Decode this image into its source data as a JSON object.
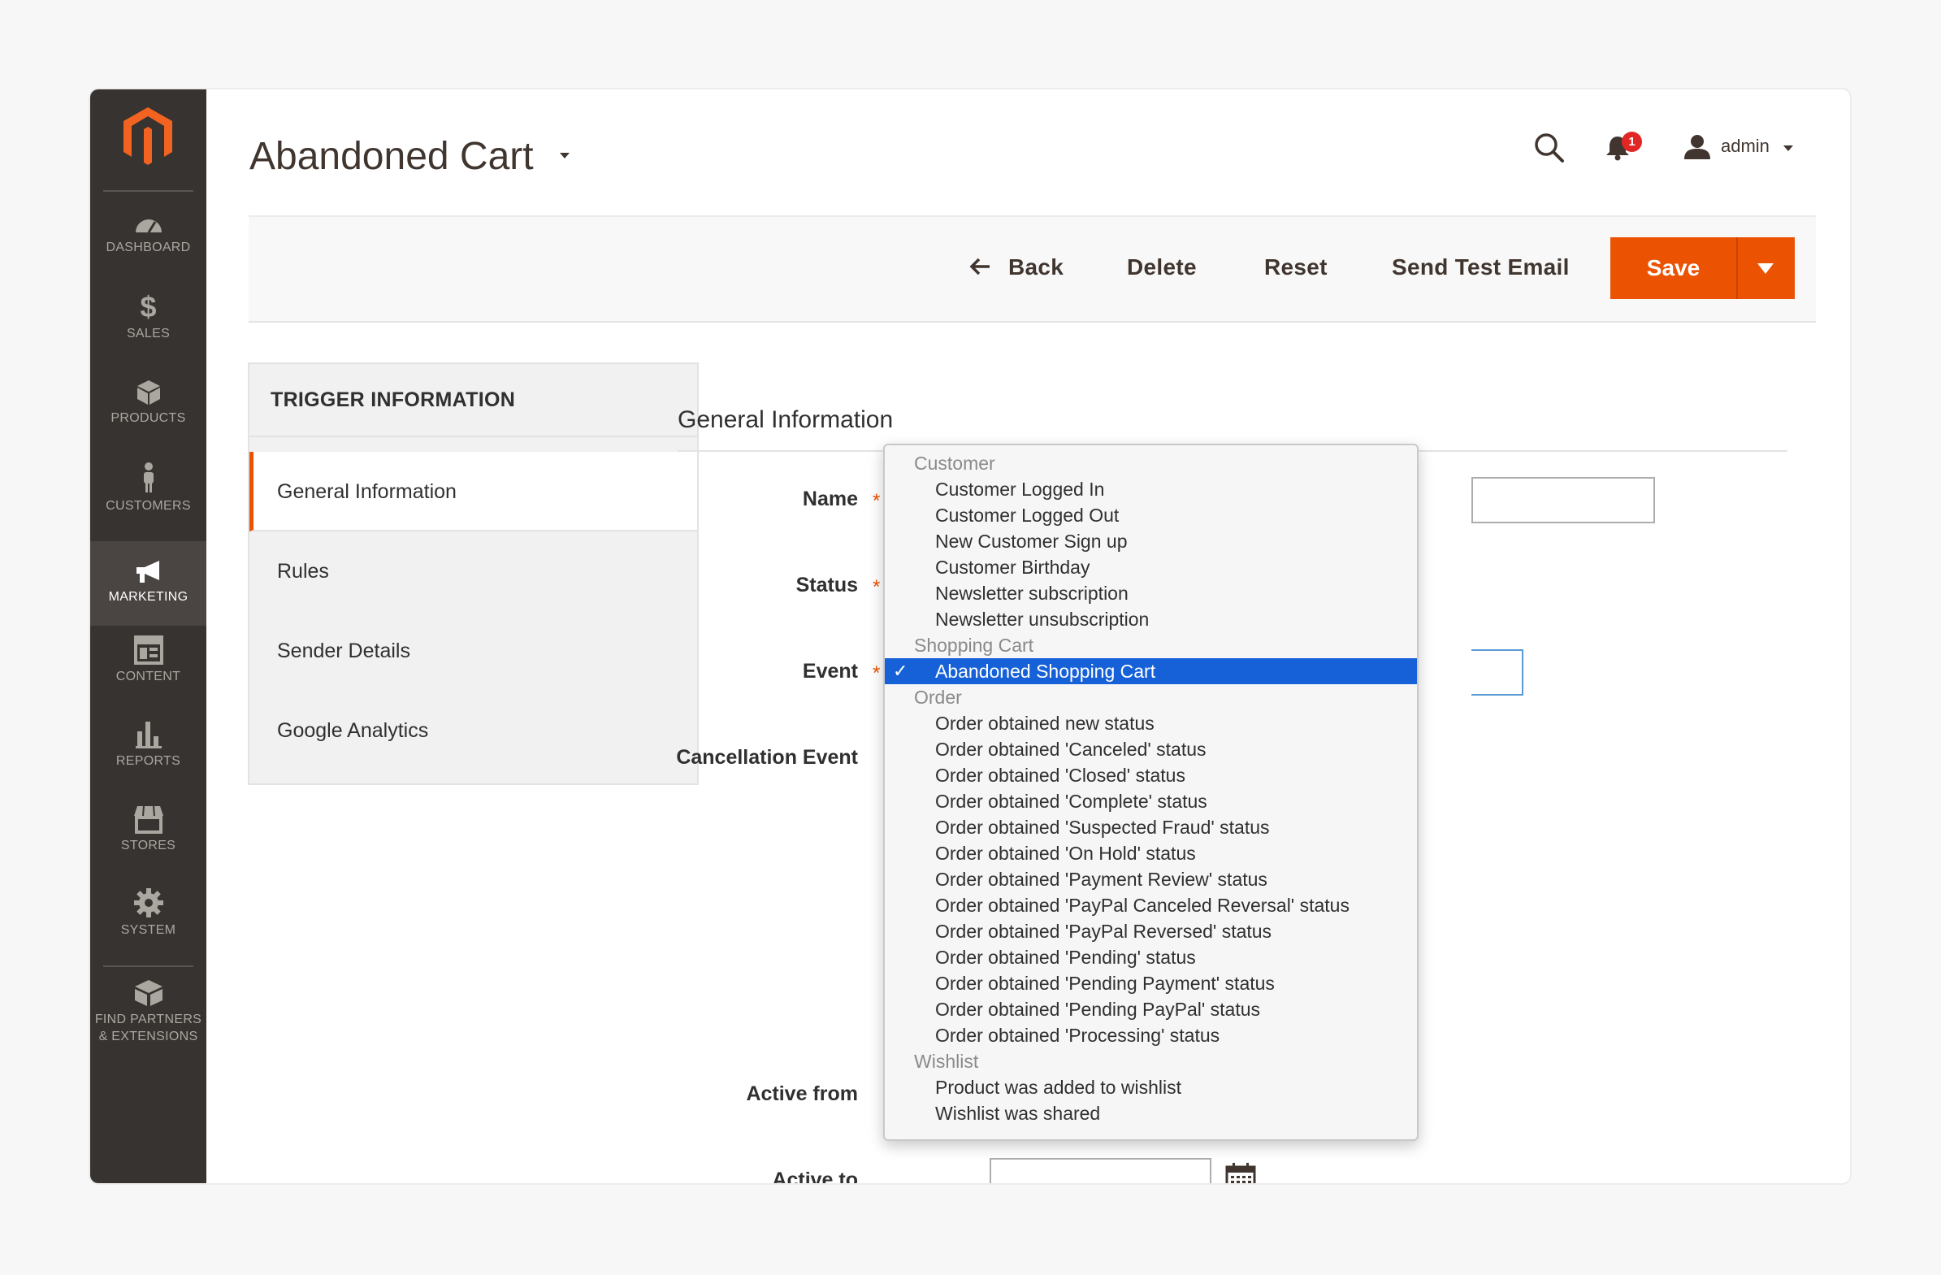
{
  "sidebar": {
    "items": [
      {
        "label": "DASHBOARD",
        "icon": "dashboard-icon"
      },
      {
        "label": "SALES",
        "icon": "dollar-icon"
      },
      {
        "label": "PRODUCTS",
        "icon": "box-icon"
      },
      {
        "label": "CUSTOMERS",
        "icon": "person-icon"
      },
      {
        "label": "MARKETING",
        "icon": "megaphone-icon",
        "active": true
      },
      {
        "label": "CONTENT",
        "icon": "layout-icon"
      },
      {
        "label": "REPORTS",
        "icon": "bar-chart-icon"
      },
      {
        "label": "STORES",
        "icon": "storefront-icon"
      },
      {
        "label": "SYSTEM",
        "icon": "gear-icon"
      },
      {
        "label": "FIND PARTNERS",
        "label2": "& EXTENSIONS",
        "icon": "blocks-icon"
      }
    ]
  },
  "header": {
    "title": "Abandoned Cart",
    "notification_count": "1",
    "user": "admin"
  },
  "actions": {
    "back": "Back",
    "delete": "Delete",
    "reset": "Reset",
    "send_test_email": "Send Test Email",
    "save": "Save"
  },
  "tabs": {
    "title": "TRIGGER INFORMATION",
    "items": [
      "General Information",
      "Rules",
      "Sender Details",
      "Google Analytics"
    ]
  },
  "form": {
    "section_title": "General Information",
    "labels": {
      "name": "Name",
      "status": "Status",
      "event": "Event",
      "cancellation_event": "Cancellation Event",
      "active_from": "Active from",
      "active_to": "Active to"
    }
  },
  "event_dropdown": {
    "selected": "Abandoned Shopping Cart",
    "groups": [
      {
        "label": "Customer",
        "options": [
          "Customer Logged In",
          "Customer Logged Out",
          "New Customer Sign up",
          "Customer Birthday",
          "Newsletter subscription",
          "Newsletter unsubscription"
        ]
      },
      {
        "label": "Shopping Cart",
        "options": [
          "Abandoned Shopping Cart"
        ]
      },
      {
        "label": "Order",
        "options": [
          "Order obtained new status",
          "Order obtained 'Canceled' status",
          "Order obtained 'Closed' status",
          "Order obtained 'Complete' status",
          "Order obtained 'Suspected Fraud' status",
          "Order obtained 'On Hold' status",
          "Order obtained 'Payment Review' status",
          "Order obtained 'PayPal Canceled Reversal' status",
          "Order obtained 'PayPal Reversed' status",
          "Order obtained 'Pending' status",
          "Order obtained 'Pending Payment' status",
          "Order obtained 'Pending PayPal' status",
          "Order obtained 'Processing' status"
        ]
      },
      {
        "label": "Wishlist",
        "options": [
          "Product was added to wishlist",
          "Wishlist was shared"
        ]
      }
    ]
  },
  "colors": {
    "accent": "#eb5202",
    "sidebar": "#373330",
    "selection": "#1761d8"
  }
}
